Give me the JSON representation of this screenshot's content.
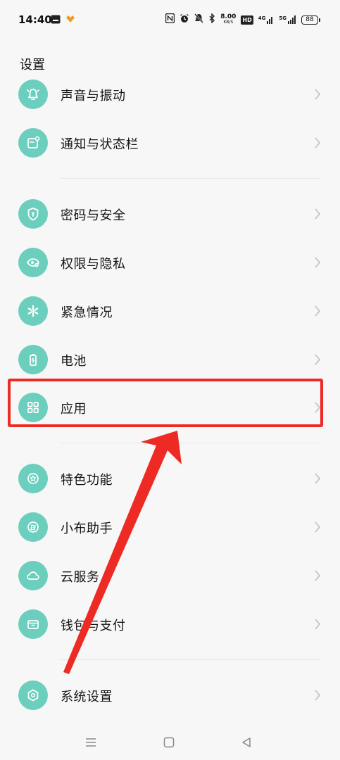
{
  "status_bar": {
    "time": "14:40",
    "network_speed": "8.00",
    "network_speed_unit": "KB/S",
    "hd_badge": "HD",
    "signal_4g": "4G",
    "signal_5g": "5G",
    "battery": "88"
  },
  "header": {
    "title": "设置"
  },
  "rows": [
    {
      "label": "声音与振动",
      "icon": "bell-icon"
    },
    {
      "label": "通知与状态栏",
      "icon": "notification-icon"
    },
    {
      "label": "密码与安全",
      "icon": "shield-icon"
    },
    {
      "label": "权限与隐私",
      "icon": "privacy-eye-icon"
    },
    {
      "label": "紧急情况",
      "icon": "emergency-icon"
    },
    {
      "label": "电池",
      "icon": "battery-icon"
    },
    {
      "label": "应用",
      "icon": "apps-grid-icon"
    },
    {
      "label": "特色功能",
      "icon": "star-icon"
    },
    {
      "label": "小布助手",
      "icon": "assistant-icon"
    },
    {
      "label": "云服务",
      "icon": "cloud-icon"
    },
    {
      "label": "钱包与支付",
      "icon": "wallet-icon"
    },
    {
      "label": "系统设置",
      "icon": "system-settings-icon"
    }
  ],
  "colors": {
    "icon_bg": "#6ccfbe",
    "highlight": "#ee2a24",
    "background": "#f7f7f7"
  }
}
